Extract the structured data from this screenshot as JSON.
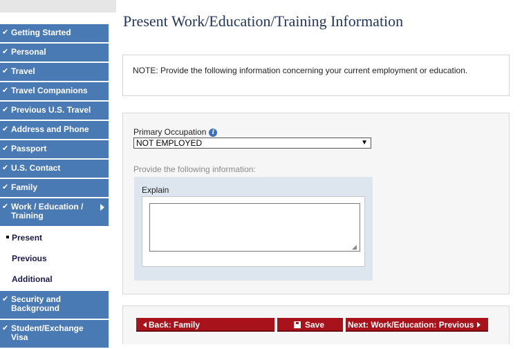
{
  "page": {
    "title": "Present Work/Education/Training Information"
  },
  "sidebar": {
    "items": [
      {
        "label": "Getting Started",
        "icon": "check-icon"
      },
      {
        "label": "Personal",
        "icon": "check-icon"
      },
      {
        "label": "Travel",
        "icon": "check-icon"
      },
      {
        "label": "Travel Companions",
        "icon": "check-icon"
      },
      {
        "label": "Previous U.S. Travel",
        "icon": "check-icon"
      },
      {
        "label": "Address and Phone",
        "icon": "check-icon"
      },
      {
        "label": "Passport",
        "icon": "check-icon"
      },
      {
        "label": "U.S. Contact",
        "icon": "check-icon"
      },
      {
        "label": "Family",
        "icon": "check-icon"
      },
      {
        "label": "Work / Education / Training",
        "icon": "check-icon",
        "expanded": true
      }
    ],
    "subitems": [
      {
        "label": "Present",
        "active": true
      },
      {
        "label": "Previous"
      },
      {
        "label": "Additional"
      }
    ],
    "items_after": [
      {
        "label": "Security and Background",
        "icon": "check-icon"
      },
      {
        "label": "Student/Exchange Visa",
        "icon": "check-icon"
      }
    ]
  },
  "note": {
    "text": "NOTE: Provide the following information concerning your current employment or education."
  },
  "form": {
    "primary_occupation_label": "Primary Occupation",
    "primary_occupation_value": "NOT EMPLOYED",
    "provide_label": "Provide the following information:",
    "explain_label": "Explain",
    "explain_value": ""
  },
  "buttons": {
    "back": "Back: Family",
    "save": "Save",
    "next": "Next: Work/Education: Previous"
  },
  "colors": {
    "sidebar_bg": "#4a7ab4",
    "button_bg": "#a8121a",
    "title_color": "#22365f"
  }
}
